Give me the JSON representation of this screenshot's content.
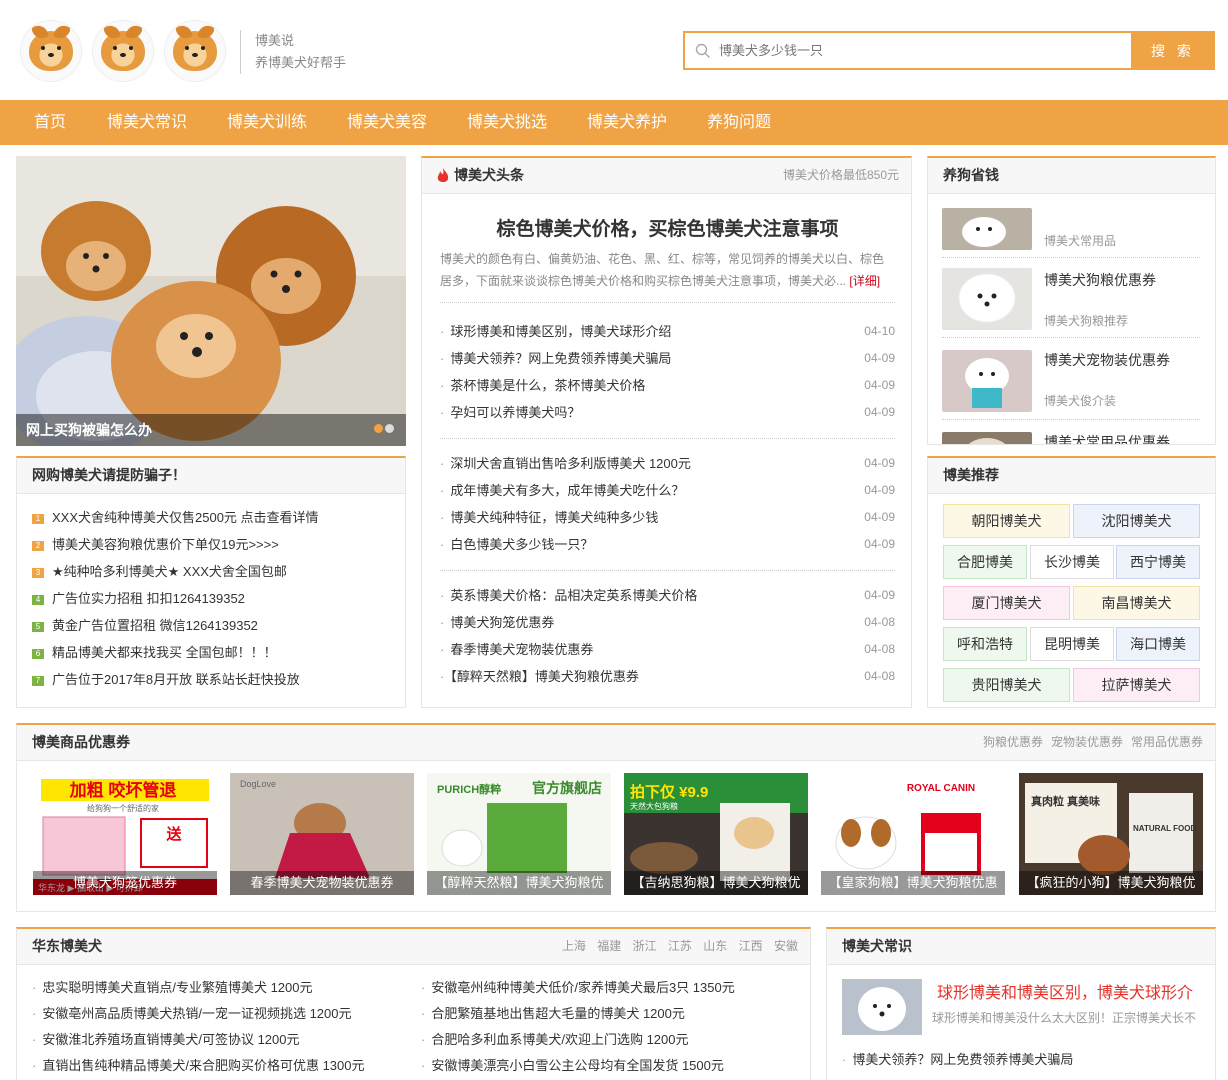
{
  "header": {
    "slogan_line1": "博美说",
    "slogan_line2": "养博美犬好帮手",
    "search_placeholder": "博美犬多少钱一只",
    "search_button": "搜 索"
  },
  "nav": [
    "首页",
    "博美犬常识",
    "博美犬训练",
    "博美犬美容",
    "博美犬挑选",
    "博美犬养护",
    "养狗问题"
  ],
  "slider": {
    "caption": "网上买狗被骗怎么办"
  },
  "warning": {
    "title": "网购博美犬请提防骗子！",
    "items": [
      "XXX犬舍纯种博美犬仅售2500元 点击查看详情",
      "博美犬美容狗粮优惠价下单仅19元>>>>",
      "★纯种哈多利博美犬★ XXX犬舍全国包邮",
      "广告位实力招租 扣扣1264139352",
      "黄金广告位置招租 微信1264139352",
      "精品博美犬都来找我买 全国包邮！！！",
      "广告位于2017年8月开放 联系站长赶快投放"
    ],
    "num_colors": [
      "#f0a345",
      "#f0a345",
      "#f0a345",
      "#7cb342",
      "#7cb342",
      "#7cb342",
      "#7cb342"
    ]
  },
  "headline": {
    "title": "博美犬头条",
    "more": "博美犬价格最低850元",
    "main_title": "棕色博美犬价格，买棕色博美犬注意事项",
    "summary": "博美犬的颜色有白、偏黄奶油、花色、黑、红、棕等，常见饲养的博美犬以白、棕色居多，下面就来谈谈棕色博美犬价格和购买棕色博美犬注意事项，博美犬必...",
    "detail": "[详细]",
    "groups": [
      [
        {
          "text": "球形博美和博美区别，博美犬球形介绍",
          "date": "04-10"
        },
        {
          "text": "博美犬领养？网上免费领养博美犬骗局",
          "date": "04-09"
        },
        {
          "text": "茶杯博美是什么，茶杯博美犬价格",
          "date": "04-09"
        },
        {
          "text": "孕妇可以养博美犬吗？",
          "date": "04-09"
        }
      ],
      [
        {
          "text": "深圳犬舍直销出售哈多利版博美犬 1200元",
          "date": "04-09"
        },
        {
          "text": "成年博美犬有多大，成年博美犬吃什么？",
          "date": "04-09"
        },
        {
          "text": "博美犬纯种特征，博美犬纯种多少钱",
          "date": "04-09"
        },
        {
          "text": "白色博美犬多少钱一只？",
          "date": "04-09"
        }
      ],
      [
        {
          "text": "英系博美犬价格：品相决定英系博美犬价格",
          "date": "04-09"
        },
        {
          "text": "博美犬狗笼优惠券",
          "date": "04-08"
        },
        {
          "text": "春季博美犬宠物装优惠券",
          "date": "04-08"
        },
        {
          "text": "【醇粹天然粮】博美犬狗粮优惠券",
          "date": "04-08"
        }
      ]
    ]
  },
  "save": {
    "title": "养狗省钱",
    "items": [
      {
        "title": "",
        "sub": "博美犬常用品"
      },
      {
        "title": "博美犬狗粮优惠券",
        "sub": "博美犬狗粮推荐"
      },
      {
        "title": "博美犬宠物装优惠券",
        "sub": "博美犬俊介装"
      },
      {
        "title": "博美犬常用品优惠券",
        "sub": ""
      }
    ]
  },
  "recommend": {
    "title": "博美推荐",
    "tags": [
      {
        "text": "朝阳博美犬",
        "bg": "#fdf8e6",
        "bd": "#f3e2a7"
      },
      {
        "text": "沈阳博美犬",
        "bg": "#eef2fb",
        "bd": "#c9d5ef"
      },
      {
        "text": "合肥博美",
        "bg": "#eef8ee",
        "bd": "#c7e6c7"
      },
      {
        "text": "长沙博美",
        "bg": "#fff",
        "bd": "#ddd"
      },
      {
        "text": "西宁博美",
        "bg": "#eef2fb",
        "bd": "#c9d5ef"
      },
      {
        "text": "厦门博美犬",
        "bg": "#fdeef6",
        "bd": "#f3c7df"
      },
      {
        "text": "南昌博美犬",
        "bg": "#fdf8e6",
        "bd": "#f3e2a7"
      },
      {
        "text": "呼和浩特",
        "bg": "#eef8ee",
        "bd": "#c7e6c7"
      },
      {
        "text": "昆明博美",
        "bg": "#fff",
        "bd": "#ddd"
      },
      {
        "text": "海口博美",
        "bg": "#eef2fb",
        "bd": "#c9d5ef"
      },
      {
        "text": "贵阳博美犬",
        "bg": "#eef8ee",
        "bd": "#c7e6c7"
      },
      {
        "text": "拉萨博美犬",
        "bg": "#fdeef6",
        "bd": "#f3c7df"
      }
    ]
  },
  "coupons": {
    "title": "博美商品优惠券",
    "more": [
      "狗粮优惠券",
      "宠物装优惠券",
      "常用品优惠券"
    ],
    "items": [
      {
        "caption": "博美犬狗笼优惠券",
        "banner_text": "加粗 咬坏管退",
        "banner_text2": "给狗狗一个舒适的家",
        "banner_text3": "送",
        "bottom_text": "华东龙 ▶ 抽取出 ▶ 可拆卸"
      },
      {
        "caption": "春季博美犬宠物装优惠券",
        "banner_text": "DogLove"
      },
      {
        "caption": "【醇粹天然粮】博美犬狗粮优",
        "banner_text": "PURICH醇粹",
        "banner_text2": "官方旗舰店"
      },
      {
        "caption": "【吉纳思狗粮】博美犬狗粮优",
        "banner_text": "拍下仅 ¥9.9",
        "banner_text2": "天然大包狗粮"
      },
      {
        "caption": "【皇家狗粮】博美犬狗粮优惠",
        "banner_text": "ROYAL CANIN"
      },
      {
        "caption": "【疯狂的小狗】博美犬狗粮优",
        "banner_text": "真肉粒 真美味",
        "banner_text2": "NATURAL FOOD"
      }
    ]
  },
  "east": {
    "title": "华东博美犬",
    "regions": [
      "上海",
      "福建",
      "浙江",
      "江苏",
      "山东",
      "江西",
      "安徽"
    ],
    "left": [
      "忠实聪明博美犬直销点/专业繁殖博美犬 1200元",
      "安徽亳州高品质博美犬热销/一宠一证视频挑选 1200元",
      "安徽淮北养殖场直销博美犬/可签协议 1200元",
      "直销出售纯种精品博美犬/来合肥购买价格可优惠 1300元"
    ],
    "right": [
      "安徽亳州纯种博美犬低价/家养博美犬最后3只 1350元",
      "合肥繁殖基地出售超大毛量的博美犬 1200元",
      "合肥哈多利血系博美犬/欢迎上门选购 1200元",
      "安徽博美漂亮小白雪公主公母均有全国发货 1500元"
    ]
  },
  "knowledge": {
    "title": "博美犬常识",
    "feature_title": "球形博美和博美区别，博美犬球形介",
    "feature_summary": "球形博美和博美没什么太大区别！正宗博美犬长不",
    "item": "博美犬领养？网上免费领养博美犬骗局"
  }
}
